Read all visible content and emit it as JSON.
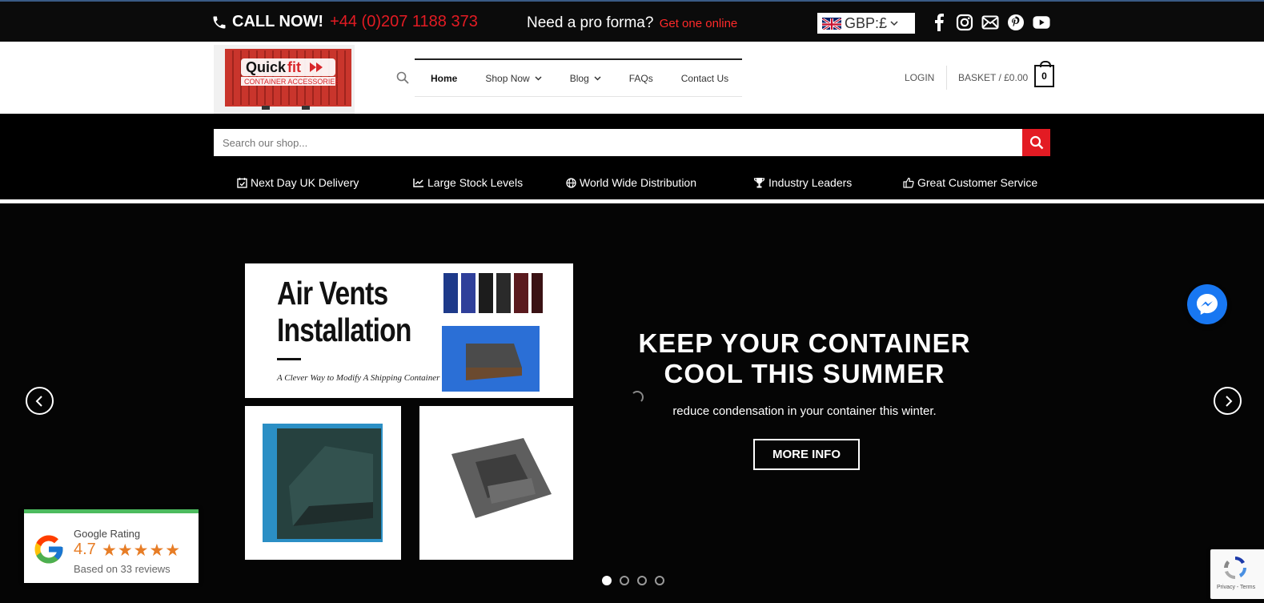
{
  "topbar": {
    "call_label": "CALL NOW!",
    "phone": "+44 (0)207 1188 373",
    "proforma_text": "Need a pro forma?",
    "proforma_link": "Get one online",
    "currency": "GBP:£",
    "socials": [
      "facebook-icon",
      "instagram-icon",
      "email-icon",
      "pinterest-icon",
      "youtube-icon"
    ]
  },
  "header": {
    "logo_text": "Quickfit",
    "logo_subtext": "CONTAINER ACCESSORIES",
    "nav": [
      {
        "label": "Home",
        "dropdown": false
      },
      {
        "label": "Shop Now",
        "dropdown": true
      },
      {
        "label": "Blog",
        "dropdown": true
      },
      {
        "label": "FAQs",
        "dropdown": false
      },
      {
        "label": "Contact Us",
        "dropdown": false
      }
    ],
    "login": "LOGIN",
    "basket": "BASKET / £0.00",
    "basket_count": "0"
  },
  "search": {
    "placeholder": "Search our shop..."
  },
  "features": [
    "Next Day UK Delivery",
    "Large Stock Levels",
    "World Wide Distribution",
    "Industry Leaders",
    "Great Customer Service"
  ],
  "hero": {
    "tile_title_line1": "Air Vents",
    "tile_title_line2": "Installation",
    "tile_subtitle": "A Clever Way to Modify A Shipping Container",
    "title_line1": "KEEP YOUR CONTAINER",
    "title_line2": "COOL THIS SUMMER",
    "subtitle": "reduce condensation in your container this winter.",
    "button": "MORE INFO",
    "slides": 4,
    "active_slide": 1
  },
  "google_rating": {
    "label": "Google Rating",
    "score": "4.7",
    "stars": "★★★★★",
    "based_on": "Based on 33 reviews"
  },
  "recaptcha": {
    "text": "Privacy - Terms"
  },
  "colors": {
    "accent_red": "#e31b23",
    "topbar_bg": "#0b0b0b",
    "google_green": "#4cbb5e",
    "rating_orange": "#e77d26",
    "messenger_blue": "#1877f2"
  }
}
